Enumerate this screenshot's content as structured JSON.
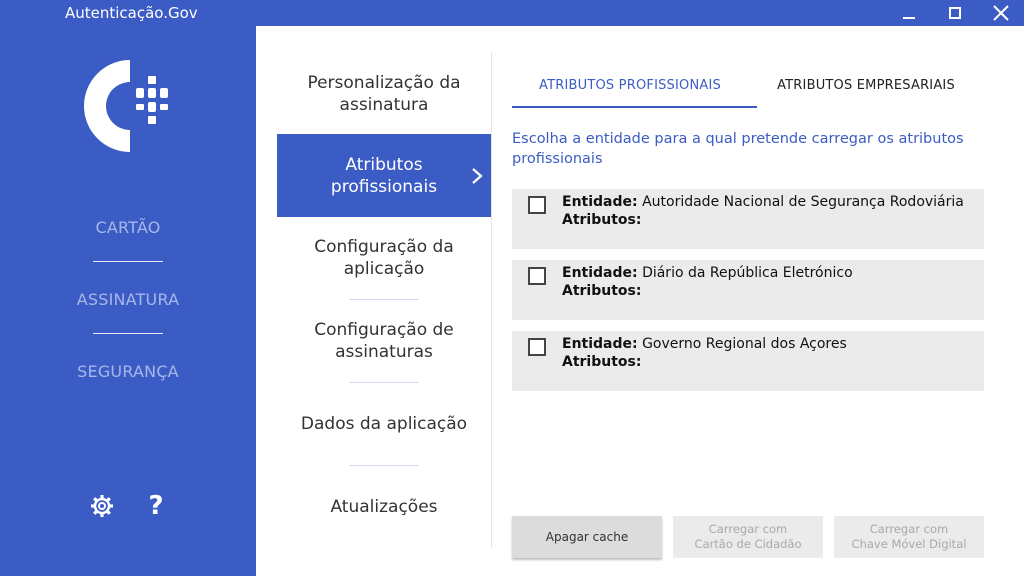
{
  "window": {
    "title": "Autenticação.Gov",
    "controls": {
      "minimize": "—",
      "maximize": "☐",
      "close": "✕"
    }
  },
  "left_nav": {
    "items": [
      {
        "label": "CARTÃO"
      },
      {
        "label": "ASSINATURA"
      },
      {
        "label": "SEGURANÇA"
      }
    ],
    "bottom_icons": [
      "gear-icon",
      "help-icon"
    ],
    "help_label": "?"
  },
  "submenu": {
    "items": [
      {
        "label": "Personalização da assinatura"
      },
      {
        "label": "Atributos profissionais",
        "active": true
      },
      {
        "label": "Configuração da aplicação"
      },
      {
        "label": "Configuração de assinaturas"
      },
      {
        "label": "Dados da aplicação"
      },
      {
        "label": "Atualizações"
      }
    ]
  },
  "tabs": [
    {
      "label": "ATRIBUTOS PROFISSIONAIS",
      "active": true
    },
    {
      "label": "ATRIBUTOS EMPRESARIAIS"
    }
  ],
  "instruction": "Escolha a entidade para a qual pretende carregar os atributos profissionais",
  "entity_label": "Entidade:",
  "attributes_label": "Atributos:",
  "entities": [
    {
      "name": "Autoridade Nacional de Segurança Rodoviária",
      "checked": false
    },
    {
      "name": "Diário da República Eletrónico",
      "checked": false
    },
    {
      "name": "Governo Regional dos Açores",
      "checked": false
    }
  ],
  "actions": {
    "clear_cache": "Apagar cache",
    "load_citizen_card_1": "Carregar com",
    "load_citizen_card_2": "Cartão de Cidadão",
    "load_mobile_key_1": "Carregar com",
    "load_mobile_key_2": "Chave Móvel Digital"
  },
  "colors": {
    "accent": "#3b5cc4",
    "nav_text": "#a8b7ea",
    "card_bg": "#ebebeb"
  }
}
